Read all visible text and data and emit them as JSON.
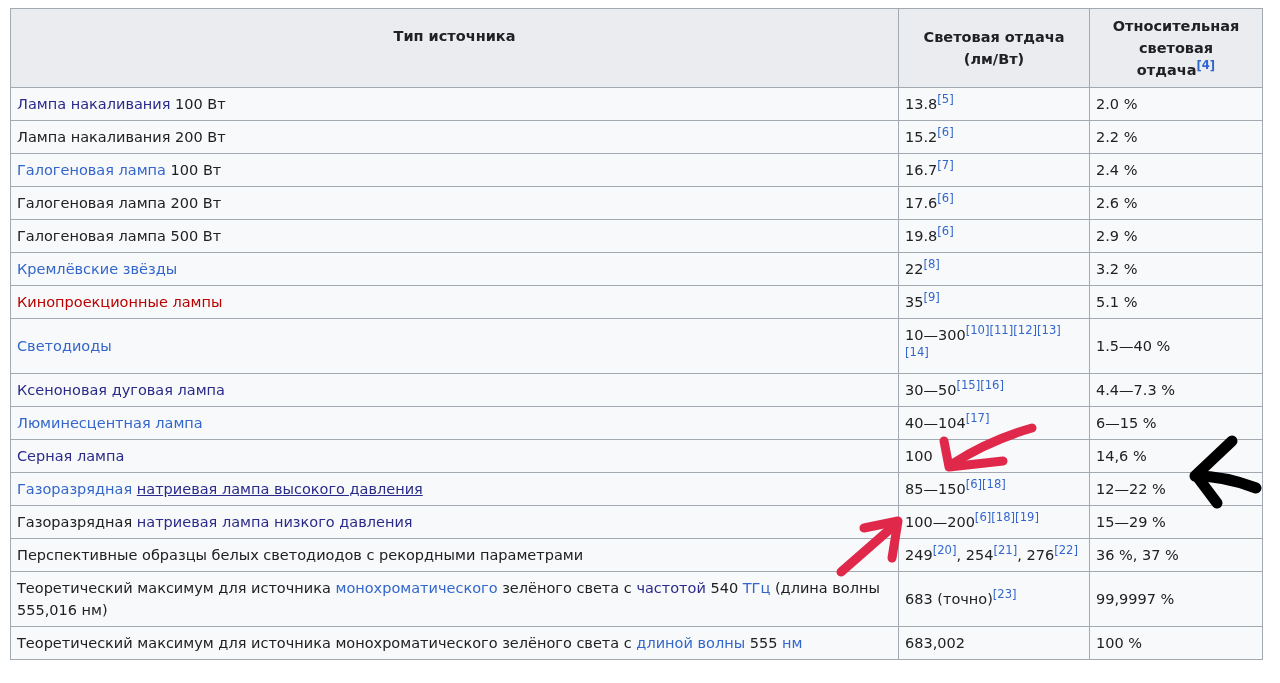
{
  "table": {
    "columns": [
      {
        "parts": [
          {
            "text": "Тип источника",
            "kind": "plain"
          }
        ]
      },
      {
        "parts": [
          {
            "text": "Световая отдача (лм/Вт)",
            "kind": "plain"
          }
        ]
      },
      {
        "parts": [
          {
            "text": "Относительная световая отдача",
            "kind": "plain"
          },
          {
            "text": "[4]",
            "kind": "ref"
          }
        ]
      }
    ],
    "rows": [
      {
        "cells": [
          {
            "parts": [
              {
                "text": "Лампа накаливания",
                "kind": "visited"
              },
              {
                "text": " 100 Вт",
                "kind": "plain"
              }
            ]
          },
          {
            "parts": [
              {
                "text": "13.8",
                "kind": "plain"
              },
              {
                "text": "[5]",
                "kind": "ref"
              }
            ]
          },
          {
            "parts": [
              {
                "text": "2.0 %",
                "kind": "plain"
              }
            ]
          }
        ]
      },
      {
        "cells": [
          {
            "parts": [
              {
                "text": "Лампа накаливания 200 Вт",
                "kind": "plain"
              }
            ]
          },
          {
            "parts": [
              {
                "text": "15.2",
                "kind": "plain"
              },
              {
                "text": "[6]",
                "kind": "ref"
              }
            ]
          },
          {
            "parts": [
              {
                "text": "2.2 %",
                "kind": "plain"
              }
            ]
          }
        ]
      },
      {
        "cells": [
          {
            "parts": [
              {
                "text": "Галогеновая лампа",
                "kind": "link"
              },
              {
                "text": " 100 Вт",
                "kind": "plain"
              }
            ]
          },
          {
            "parts": [
              {
                "text": "16.7",
                "kind": "plain"
              },
              {
                "text": "[7]",
                "kind": "ref"
              }
            ]
          },
          {
            "parts": [
              {
                "text": "2.4 %",
                "kind": "plain"
              }
            ]
          }
        ]
      },
      {
        "cells": [
          {
            "parts": [
              {
                "text": "Галогеновая лампа 200 Вт",
                "kind": "plain"
              }
            ]
          },
          {
            "parts": [
              {
                "text": "17.6",
                "kind": "plain"
              },
              {
                "text": "[6]",
                "kind": "ref"
              }
            ]
          },
          {
            "parts": [
              {
                "text": "2.6 %",
                "kind": "plain"
              }
            ]
          }
        ]
      },
      {
        "cells": [
          {
            "parts": [
              {
                "text": "Галогеновая лампа 500 Вт",
                "kind": "plain"
              }
            ]
          },
          {
            "parts": [
              {
                "text": "19.8",
                "kind": "plain"
              },
              {
                "text": "[6]",
                "kind": "ref"
              }
            ]
          },
          {
            "parts": [
              {
                "text": "2.9 %",
                "kind": "plain"
              }
            ]
          }
        ]
      },
      {
        "cells": [
          {
            "parts": [
              {
                "text": "Кремлёвские звёзды",
                "kind": "link"
              }
            ]
          },
          {
            "parts": [
              {
                "text": "22",
                "kind": "plain"
              },
              {
                "text": "[8]",
                "kind": "ref"
              }
            ]
          },
          {
            "parts": [
              {
                "text": "3.2 %",
                "kind": "plain"
              }
            ]
          }
        ]
      },
      {
        "cells": [
          {
            "parts": [
              {
                "text": "Кинопроекционные лампы",
                "kind": "redlink"
              }
            ]
          },
          {
            "parts": [
              {
                "text": "35",
                "kind": "plain"
              },
              {
                "text": "[9]",
                "kind": "ref"
              }
            ]
          },
          {
            "parts": [
              {
                "text": "5.1 %",
                "kind": "plain"
              }
            ]
          }
        ]
      },
      {
        "cells": [
          {
            "parts": [
              {
                "text": "Светодиоды",
                "kind": "link"
              }
            ]
          },
          {
            "parts": [
              {
                "text": "10—300",
                "kind": "plain"
              },
              {
                "text": "[10]",
                "kind": "ref"
              },
              {
                "text": "[11]",
                "kind": "ref"
              },
              {
                "text": "[12]",
                "kind": "ref"
              },
              {
                "text": "[13]",
                "kind": "ref"
              },
              {
                "text": "[14]",
                "kind": "ref"
              }
            ]
          },
          {
            "parts": [
              {
                "text": "1.5—40 %",
                "kind": "plain"
              }
            ]
          }
        ]
      },
      {
        "cells": [
          {
            "parts": [
              {
                "text": "Ксеноновая дуговая лампа",
                "kind": "visited"
              }
            ]
          },
          {
            "parts": [
              {
                "text": "30—50",
                "kind": "plain"
              },
              {
                "text": "[15]",
                "kind": "ref"
              },
              {
                "text": "[16]",
                "kind": "ref"
              }
            ]
          },
          {
            "parts": [
              {
                "text": "4.4—7.3 %",
                "kind": "plain"
              }
            ]
          }
        ]
      },
      {
        "cells": [
          {
            "parts": [
              {
                "text": "Люминесцентная лампа",
                "kind": "link"
              }
            ]
          },
          {
            "parts": [
              {
                "text": "40—104",
                "kind": "plain"
              },
              {
                "text": "[17]",
                "kind": "ref"
              }
            ]
          },
          {
            "parts": [
              {
                "text": "6—15 %",
                "kind": "plain"
              }
            ]
          }
        ]
      },
      {
        "cells": [
          {
            "parts": [
              {
                "text": "Серная лампа",
                "kind": "visited"
              }
            ]
          },
          {
            "parts": [
              {
                "text": "100",
                "kind": "plain"
              }
            ]
          },
          {
            "parts": [
              {
                "text": "14,6 %",
                "kind": "plain"
              }
            ]
          }
        ]
      },
      {
        "cells": [
          {
            "parts": [
              {
                "text": "Газоразрядная",
                "kind": "link"
              },
              {
                "text": "натриевая лампа высокого давления",
                "kind": "hover"
              }
            ]
          },
          {
            "parts": [
              {
                "text": "85—150",
                "kind": "plain"
              },
              {
                "text": "[6]",
                "kind": "ref"
              },
              {
                "text": "[18]",
                "kind": "ref"
              }
            ]
          },
          {
            "parts": [
              {
                "text": "12—22 %",
                "kind": "plain"
              }
            ]
          }
        ]
      },
      {
        "cells": [
          {
            "parts": [
              {
                "text": "Газоразрядная ",
                "kind": "plain"
              },
              {
                "text": "натриевая лампа низкого давления",
                "kind": "visited"
              }
            ]
          },
          {
            "parts": [
              {
                "text": "100—200",
                "kind": "plain"
              },
              {
                "text": "[6]",
                "kind": "ref"
              },
              {
                "text": "[18]",
                "kind": "ref"
              },
              {
                "text": "[19]",
                "kind": "ref"
              }
            ]
          },
          {
            "parts": [
              {
                "text": "15—29 %",
                "kind": "plain"
              }
            ]
          }
        ]
      },
      {
        "cells": [
          {
            "parts": [
              {
                "text": "Перспективные образцы белых светодиодов с рекордными параметрами",
                "kind": "plain"
              }
            ]
          },
          {
            "parts": [
              {
                "text": "249",
                "kind": "plain"
              },
              {
                "text": "[20]",
                "kind": "ref"
              },
              {
                "text": ", 254",
                "kind": "plain"
              },
              {
                "text": "[21]",
                "kind": "ref"
              },
              {
                "text": ", 276",
                "kind": "plain"
              },
              {
                "text": "[22]",
                "kind": "ref"
              }
            ]
          },
          {
            "parts": [
              {
                "text": "36 %, 37 %",
                "kind": "plain"
              }
            ]
          }
        ]
      },
      {
        "cells": [
          {
            "parts": [
              {
                "text": "Теоретический максимум для источника ",
                "kind": "plain"
              },
              {
                "text": "монохроматического",
                "kind": "link"
              },
              {
                "text": " зелёного света с ",
                "kind": "plain"
              },
              {
                "text": "частотой",
                "kind": "visited"
              },
              {
                "text": " 540 ",
                "kind": "plain"
              },
              {
                "text": "ТГц",
                "kind": "link"
              },
              {
                "text": " (длина волны 555,016 нм)",
                "kind": "plain"
              }
            ]
          },
          {
            "parts": [
              {
                "text": "683 (точно)",
                "kind": "plain"
              },
              {
                "text": "[23]",
                "kind": "ref"
              }
            ]
          },
          {
            "parts": [
              {
                "text": "99,9997 %",
                "kind": "plain"
              }
            ]
          }
        ]
      },
      {
        "cells": [
          {
            "parts": [
              {
                "text": "Теоретический максимум для источника монохроматического зелёного света с ",
                "kind": "plain"
              },
              {
                "text": "длиной волны",
                "kind": "link"
              },
              {
                "text": " 555 ",
                "kind": "plain"
              },
              {
                "text": "нм",
                "kind": "link"
              }
            ]
          },
          {
            "parts": [
              {
                "text": "683,002",
                "kind": "plain"
              }
            ]
          },
          {
            "parts": [
              {
                "text": "100 %",
                "kind": "plain"
              }
            ]
          }
        ]
      }
    ]
  }
}
